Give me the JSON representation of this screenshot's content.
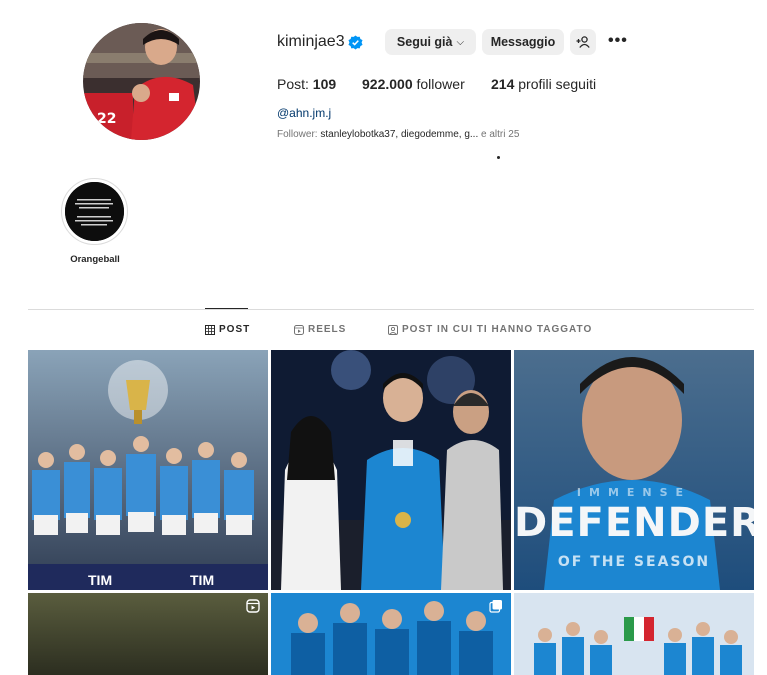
{
  "profile": {
    "username": "kiminjae3",
    "follow_button": "Segui già",
    "message_button": "Messaggio",
    "add_user_icon": "add-person-icon",
    "more_icon": "more-horizontal-icon",
    "stats": {
      "posts_label": "Post:",
      "posts_count": "109",
      "followers_count": "922.000",
      "followers_label": "follower",
      "following_count": "214",
      "following_label": "profili seguiti"
    },
    "link": "@ahn.jm.j",
    "followed_by_prefix": "Follower:",
    "followed_by_names": "stanleylobotka37, diegodemme, g...",
    "followed_by_suffix": "e altri 25"
  },
  "highlights": [
    {
      "label": "Orangeball"
    }
  ],
  "tabs": [
    {
      "label": "POST",
      "icon": "grid-icon",
      "active": true
    },
    {
      "label": "REELS",
      "icon": "reels-icon",
      "active": false
    },
    {
      "label": "POST IN CUI TI HANNO TAGGATO",
      "icon": "tagged-icon",
      "active": false
    }
  ],
  "posts": [
    {
      "name": "trophy-celebration",
      "overlay_text": "TIM"
    },
    {
      "name": "medal-photo"
    },
    {
      "name": "defender-of-the-season",
      "top_text": "IMMENSE",
      "big_text": "DEFENDER",
      "bottom_text": "OF THE SEASON"
    },
    {
      "name": "dark-reel",
      "icon": "reels-icon"
    },
    {
      "name": "team-collage",
      "icon": "carousel-icon"
    },
    {
      "name": "team-group-photo"
    }
  ],
  "colors": {
    "link": "#00376b",
    "verified": "#0095f6",
    "button_bg": "#efefef",
    "napoli_blue": "#1c86d1"
  }
}
